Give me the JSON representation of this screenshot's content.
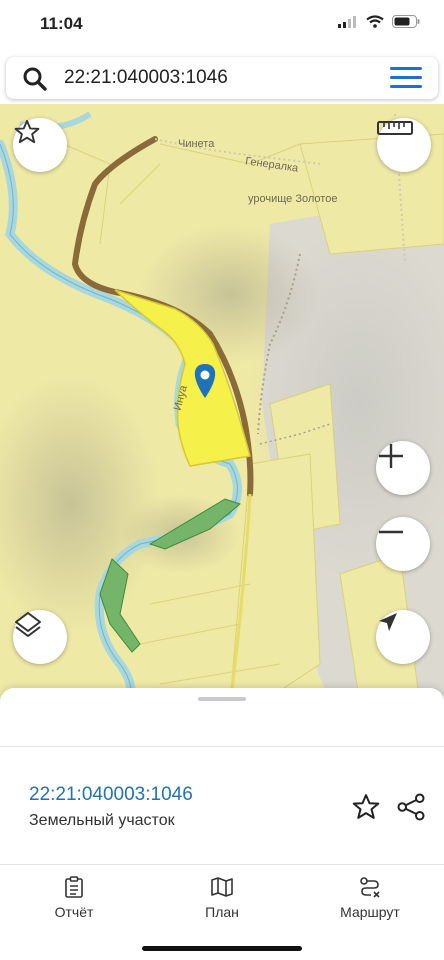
{
  "status": {
    "time": "11:04"
  },
  "search": {
    "value": "22:21:040003:1046"
  },
  "map": {
    "labels": {
      "place_1": "Чинета",
      "place_2": "Генералка",
      "place_3": "урочище Золотое",
      "river": "Инya"
    }
  },
  "sheet": {
    "parcel_id": "22:21:040003:1046",
    "parcel_type": "Земельный участок"
  },
  "tabs": [
    {
      "label": "Отчёт",
      "icon": "report-icon"
    },
    {
      "label": "План",
      "icon": "map-plan-icon"
    },
    {
      "label": "Маршрут",
      "icon": "route-icon"
    }
  ],
  "colors": {
    "accent": "#1f73b7",
    "parcel": "#f6f04a",
    "map_base": "#efe9a6",
    "river": "#a8d7de"
  }
}
